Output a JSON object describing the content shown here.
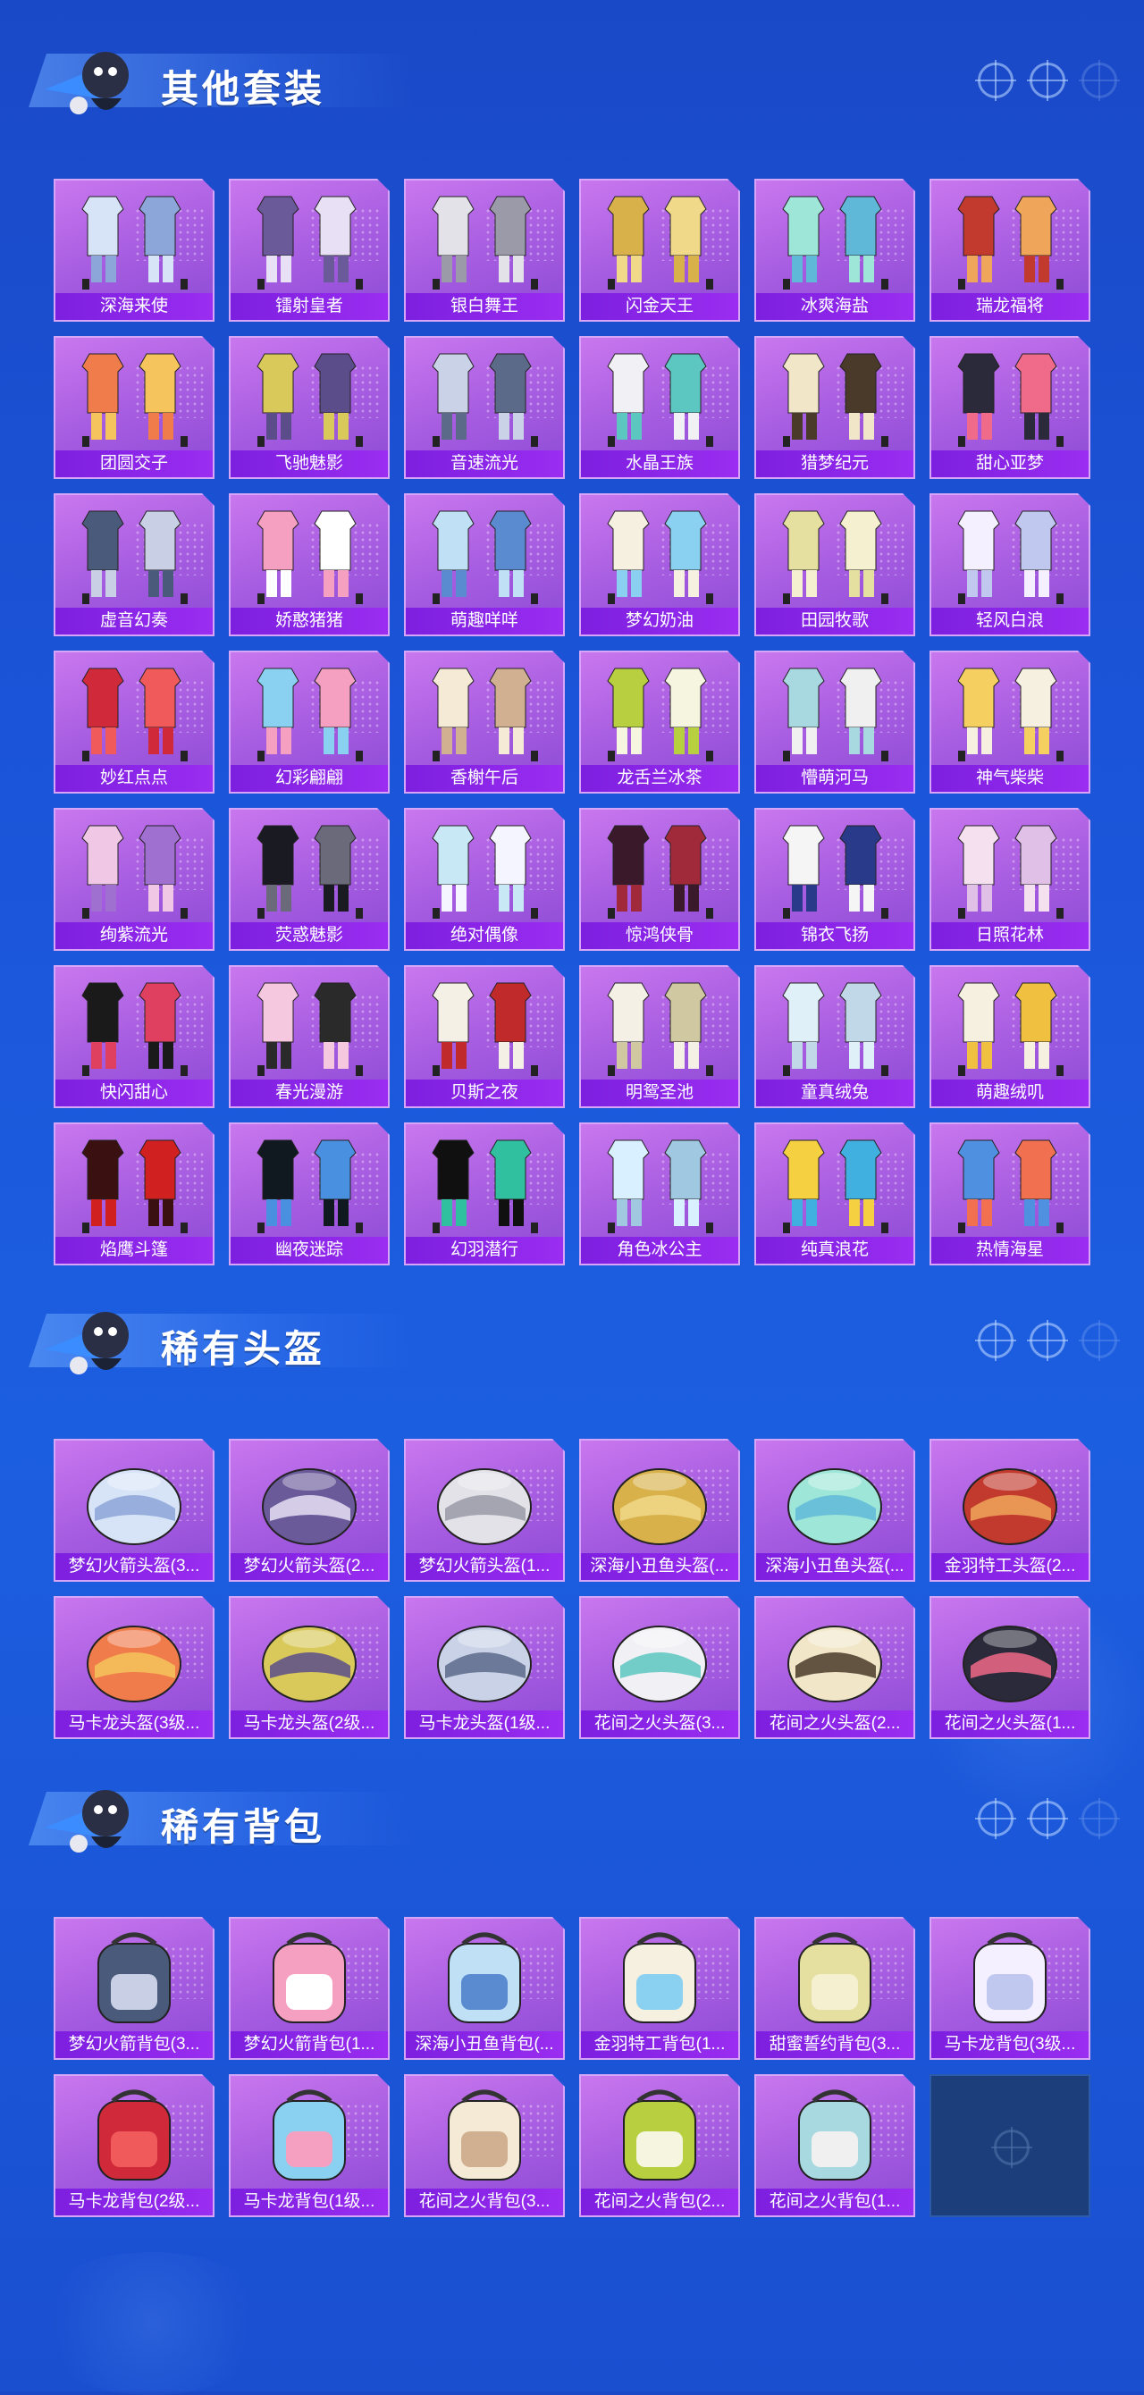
{
  "sections": [
    {
      "title": "其他套装",
      "type": "outfit",
      "items": [
        "深海来使",
        "镭射皇者",
        "银白舞王",
        "闪金天王",
        "冰爽海盐",
        "瑞龙福将",
        "团圆交子",
        "飞驰魅影",
        "音速流光",
        "水晶王族",
        "猎梦纪元",
        "甜心亚梦",
        "虚音幻奏",
        "娇憨猪猪",
        "萌趣咩咩",
        "梦幻奶油",
        "田园牧歌",
        "轻风白浪",
        "妙红点点",
        "幻彩翩翩",
        "香榭午后",
        "龙舌兰冰茶",
        "懵萌河马",
        "神气柴柴",
        "绚紫流光",
        "荧惑魅影",
        "绝对偶像",
        "惊鸿侠骨",
        "锦衣飞扬",
        "日照花林",
        "快闪甜心",
        "春光漫游",
        "贝斯之夜",
        "明鸳圣池",
        "童真绒兔",
        "萌趣绒叽",
        "焰鹰斗篷",
        "幽夜迷踪",
        "幻羽潜行",
        "角色冰公主",
        "纯真浪花",
        "热情海星"
      ]
    },
    {
      "title": "稀有头盔",
      "type": "helmet",
      "items": [
        "梦幻火箭头盔(3...",
        "梦幻火箭头盔(2...",
        "梦幻火箭头盔(1...",
        "深海小丑鱼头盔(...",
        "深海小丑鱼头盔(...",
        "金羽特工头盔(2...",
        "马卡龙头盔(3级...",
        "马卡龙头盔(2级...",
        "马卡龙头盔(1级...",
        "花间之火头盔(3...",
        "花间之火头盔(2...",
        "花间之火头盔(1..."
      ]
    },
    {
      "title": "稀有背包",
      "type": "backpack",
      "items": [
        "梦幻火箭背包(3...",
        "梦幻火箭背包(1...",
        "深海小丑鱼背包(...",
        "金羽特工背包(1...",
        "甜蜜誓约背包(3...",
        "马卡龙背包(3级...",
        "马卡龙背包(2级...",
        "马卡龙背包(1级...",
        "花间之火背包(3...",
        "花间之火背包(2...",
        "花间之火背包(1..."
      ]
    }
  ],
  "colors": {
    "accent": "#9a2df0",
    "card": "#b265e6",
    "background": "#1b54d8"
  },
  "icons": [
    "mascot-icon",
    "crosshair-icon"
  ]
}
